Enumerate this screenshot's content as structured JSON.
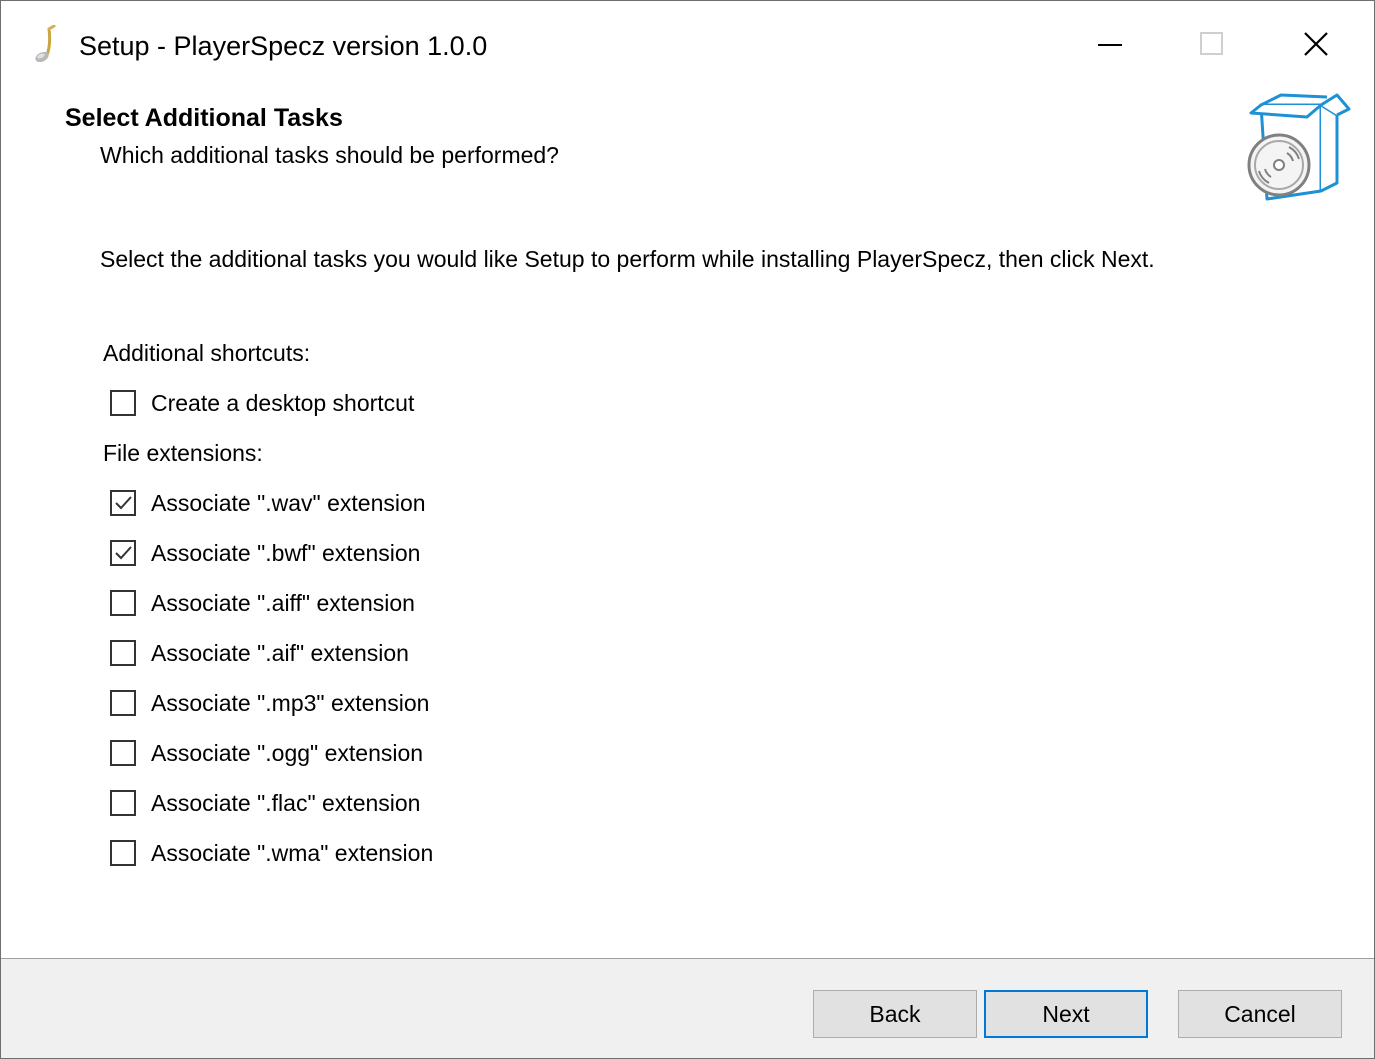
{
  "window": {
    "title": "Setup - PlayerSpecz version 1.0.0",
    "icon": "music-note-icon",
    "controls": {
      "minimize": "minimize-icon",
      "maximize": "maximize-icon",
      "close": "close-icon"
    }
  },
  "header": {
    "title": "Select Additional Tasks",
    "subtitle": "Which additional tasks should be performed?",
    "image": "software-box-cd-icon"
  },
  "body": {
    "instructions": "Select the additional tasks you would like Setup to perform while installing PlayerSpecz, then click Next.",
    "groups": [
      {
        "label": "Additional shortcuts:",
        "tasks": [
          {
            "label": "Create a desktop shortcut",
            "checked": false
          }
        ]
      },
      {
        "label": "File extensions:",
        "tasks": [
          {
            "label": "Associate \".wav\" extension",
            "checked": true
          },
          {
            "label": "Associate \".bwf\" extension",
            "checked": true
          },
          {
            "label": "Associate \".aiff\" extension",
            "checked": false
          },
          {
            "label": "Associate \".aif\" extension",
            "checked": false
          },
          {
            "label": "Associate \".mp3\" extension",
            "checked": false
          },
          {
            "label": "Associate \".ogg\" extension",
            "checked": false
          },
          {
            "label": "Associate \".flac\" extension",
            "checked": false
          },
          {
            "label": "Associate \".wma\" extension",
            "checked": false
          }
        ]
      }
    ]
  },
  "footer": {
    "back_label": "Back",
    "next_label": "Next",
    "cancel_label": "Cancel",
    "default_button": "Next"
  },
  "colors": {
    "accent": "#0078d7",
    "footer_bg": "#f0f0f0",
    "button_bg": "#e1e1e1",
    "box_blue": "#1e90d6"
  }
}
